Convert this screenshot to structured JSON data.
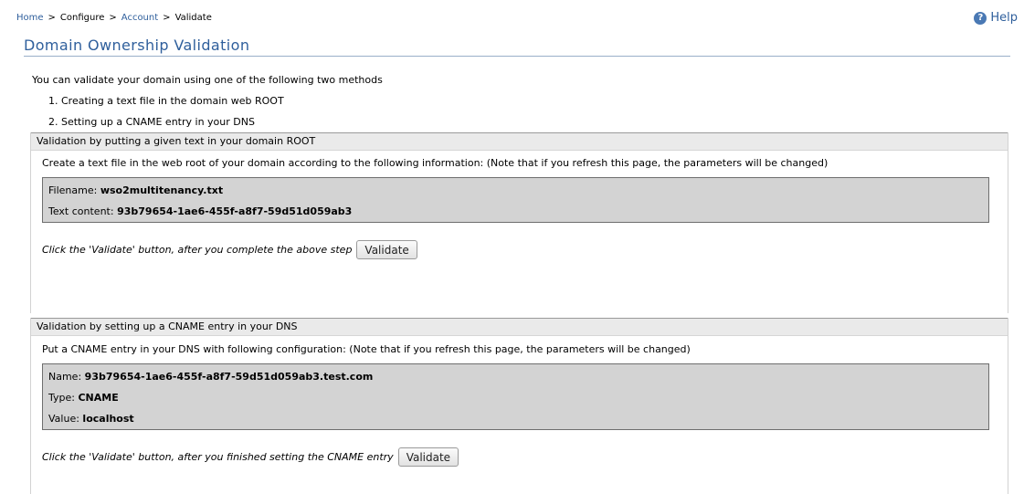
{
  "breadcrumb": {
    "home": "Home",
    "configure": "Configure",
    "account": "Account",
    "current": "Validate",
    "separator": ">"
  },
  "help": {
    "label": "Help",
    "icon": "help-icon"
  },
  "page_title": "Domain Ownership Validation",
  "intro": {
    "text": "You can validate your domain using one of the following two methods",
    "methods": [
      "1. Creating a text file in the domain web ROOT",
      "2. Setting up a CNAME entry in your DNS"
    ]
  },
  "text_file_section": {
    "header": "Validation by putting a given text in your domain ROOT",
    "description": "Create a text file in the web root of your domain according to the following information: (Note that if you refresh this page, the parameters will be changed)",
    "filename_label": "Filename:",
    "filename_value": "wso2multitenancy.txt",
    "content_label": "Text content:",
    "content_value": "93b79654-1ae6-455f-a8f7-59d51d059ab3",
    "instruction": "Click the 'Validate' button, after you complete the above step",
    "button": "Validate"
  },
  "cname_section": {
    "header": "Validation by setting up a CNAME entry in your DNS",
    "description": "Put a CNAME entry in your DNS with following configuration: (Note that if you refresh this page, the parameters will be changed)",
    "name_label": "Name:",
    "name_value": "93b79654-1ae6-455f-a8f7-59d51d059ab3.test.com",
    "type_label": "Type:",
    "type_value": "CNAME",
    "value_label": "Value:",
    "value_value": "localhost",
    "instruction": "Click the 'Validate' button, after you finished setting the CNAME entry",
    "button": "Validate"
  },
  "colors": {
    "link": "#2f5f9c",
    "section_header_bg": "#eaeaea",
    "info_box_bg": "#d3d3d3"
  }
}
